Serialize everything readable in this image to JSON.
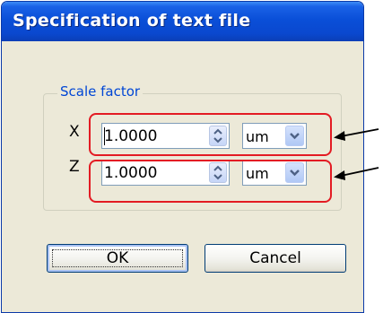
{
  "dialog": {
    "title": "Specification of text file"
  },
  "scale_group": {
    "label": "Scale factor",
    "rows": [
      {
        "axis": "X",
        "value": "1.0000",
        "unit": "um"
      },
      {
        "axis": "Z",
        "value": "1.0000",
        "unit": "um"
      }
    ]
  },
  "buttons": {
    "ok": "OK",
    "cancel": "Cancel"
  },
  "colors": {
    "titlebar": "#0a4fd8",
    "dialog_bg": "#ece9d8",
    "group_label": "#0046d5",
    "highlight": "#e31b23"
  },
  "icons": {
    "spin": "up-down-arrows-icon",
    "dropdown": "chevron-down-icon",
    "callout": "arrow-icon"
  }
}
